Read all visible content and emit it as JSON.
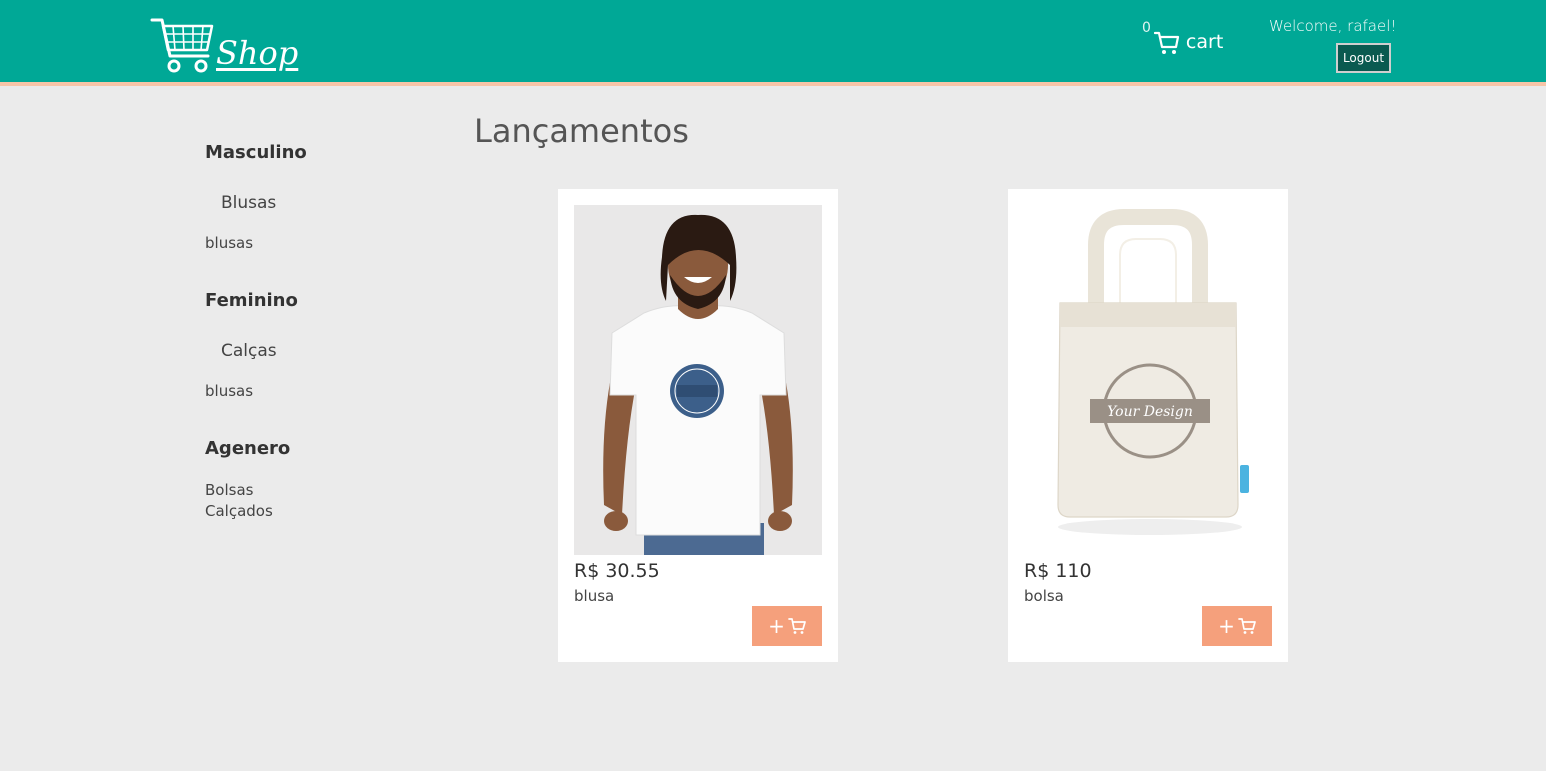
{
  "header": {
    "logo_text": "Shop",
    "cart_count": "0",
    "cart_label": "cart",
    "welcome": "Welcome, rafael!",
    "logout_label": "Logout"
  },
  "sidebar": {
    "categories": [
      {
        "title": "Masculino",
        "subcategory": "Blusas",
        "items": [
          "blusas"
        ]
      },
      {
        "title": "Feminino",
        "subcategory": "Calças",
        "items": [
          "blusas"
        ]
      },
      {
        "title": "Agenero",
        "items": [
          "Bolsas",
          "Calçados"
        ]
      }
    ]
  },
  "main": {
    "title": "Lançamentos",
    "products": [
      {
        "price": "R$ 30.55",
        "name": "blusa",
        "image": "man-white-tshirt-photo"
      },
      {
        "price": "R$ 110",
        "name": "bolsa",
        "image": "tote-bag-photo"
      }
    ],
    "add_label": "+"
  },
  "colors": {
    "header_bg": "#00a896",
    "header_border": "#f7c5a8",
    "page_bg": "#ebebeb",
    "add_button": "#f5a07c",
    "logout_bg": "#0a5a50"
  }
}
